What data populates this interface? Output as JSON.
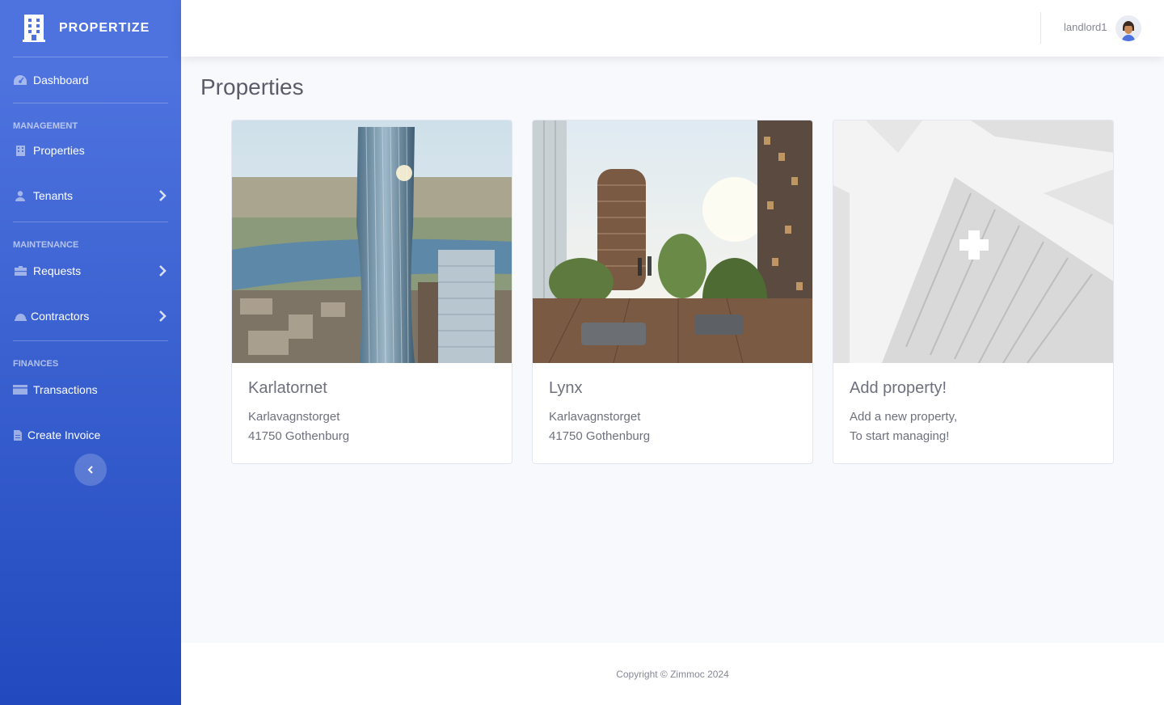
{
  "brand": {
    "name": "PROPERTIZE"
  },
  "sidebar": {
    "dashboard": "Dashboard",
    "headings": {
      "management": "MANAGEMENT",
      "maintenance": "MAINTENANCE",
      "finances": "FINANCES"
    },
    "items": {
      "properties": "Properties",
      "tenants": "Tenants",
      "requests": "Requests",
      "contractors": "Contractors",
      "transactions": "Transactions",
      "create_invoice": "Create Invoice"
    }
  },
  "topbar": {
    "user": "landlord1"
  },
  "page": {
    "title": "Properties"
  },
  "cards": [
    {
      "title": "Karlatornet",
      "line1": "Karlavagnstorget",
      "line2": "41750 Gothenburg"
    },
    {
      "title": "Lynx",
      "line1": "Karlavagnstorget",
      "line2": "41750 Gothenburg"
    },
    {
      "title": "Add property!",
      "line1": "Add a new property,",
      "line2": "To start managing!"
    }
  ],
  "footer": {
    "text": "Copyright © Zimmoc 2024"
  },
  "colors": {
    "sidebar_top": "#4e73df",
    "sidebar_bottom": "#224abe",
    "background": "#f8f9fc"
  }
}
